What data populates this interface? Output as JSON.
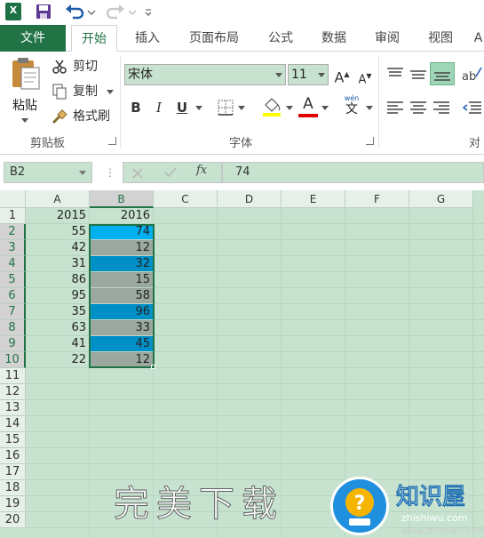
{
  "app": {
    "logo_letter": "X"
  },
  "tabs": [
    "文件",
    "开始",
    "插入",
    "页面布局",
    "公式",
    "数据",
    "审阅",
    "视图",
    "A"
  ],
  "clipboard": {
    "paste": "粘贴",
    "cut": "剪切",
    "copy": "复制",
    "format_painter": "格式刷",
    "group_label": "剪贴板"
  },
  "font": {
    "name": "宋体",
    "size": "11",
    "grow": "A",
    "shrink": "A",
    "bold": "B",
    "italic": "I",
    "underline": "U",
    "font_color_glyph": "A",
    "phonetic": "wén",
    "phonetic_char": "文",
    "group_label": "字体"
  },
  "alignment": {
    "group_label_partial": "对"
  },
  "formula_bar": {
    "name_box": "B2",
    "fx": "fx",
    "value": "74"
  },
  "sheet": {
    "columns": [
      "A",
      "B",
      "C",
      "D",
      "E",
      "F",
      "G"
    ],
    "rows": [
      "1",
      "2",
      "3",
      "4",
      "5",
      "6",
      "7",
      "8",
      "9",
      "10",
      "11",
      "12",
      "13",
      "14",
      "15",
      "16",
      "17",
      "18",
      "19",
      "20"
    ],
    "col_a": [
      "2015",
      "55",
      "42",
      "31",
      "86",
      "95",
      "35",
      "63",
      "41",
      "22"
    ],
    "col_b": [
      "2016",
      "74",
      "12",
      "32",
      "15",
      "58",
      "96",
      "33",
      "45",
      "12"
    ],
    "col_b_fills": [
      "",
      "#00b0f0",
      "#9aa8a0",
      "#0090c8",
      "#9aa8a0",
      "#9aa8a0",
      "#0090c8",
      "#9aa8a0",
      "#0090c8",
      "#9aa8a0"
    ]
  },
  "watermark": {
    "text": "完美下载"
  },
  "site_logo": {
    "name": "知识屋",
    "domain": "zhishiwu.com",
    "url": "www.zhishiwu.com"
  },
  "colors": {
    "accent": "#217346",
    "sheet_bg": "#c7e3d0"
  }
}
